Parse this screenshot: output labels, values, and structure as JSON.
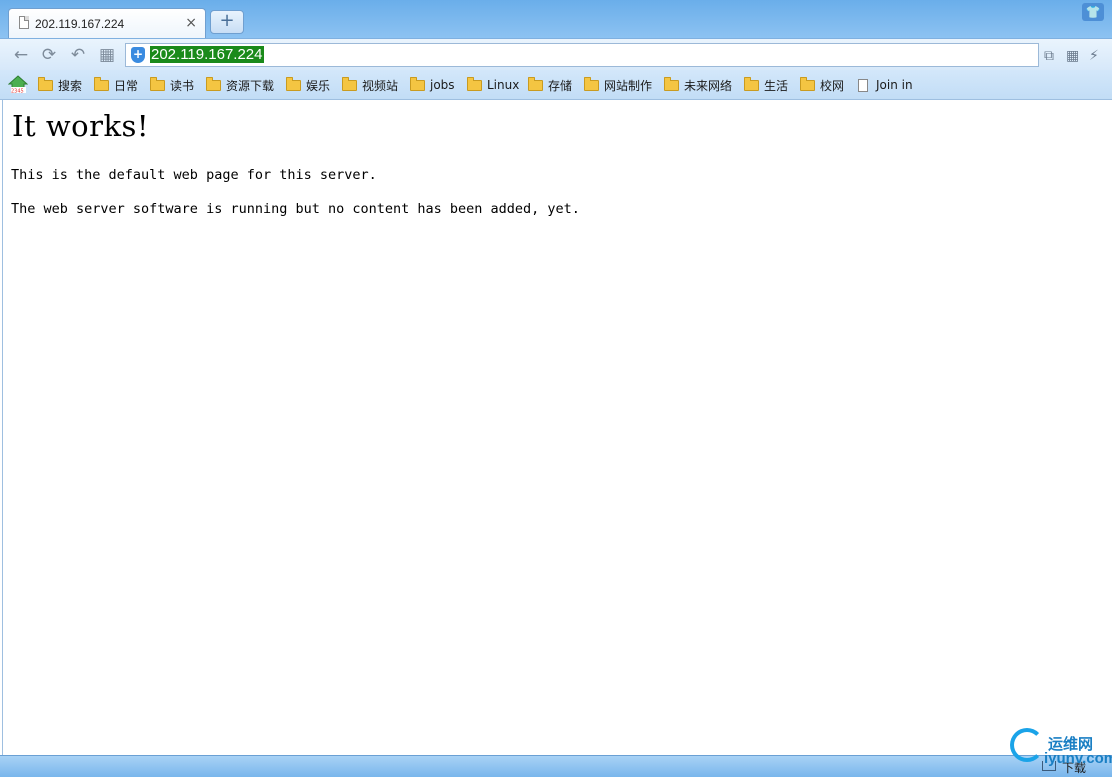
{
  "browser": {
    "tab": {
      "title": "202.119.167.224",
      "close": "×"
    },
    "new_tab": "+",
    "skin": "👕",
    "toolbar": {
      "back": "←",
      "reload": "⟳",
      "undo": "↶",
      "apps": "▦",
      "address": "202.119.167.224",
      "right_icons": [
        "⧉",
        "▦",
        "⚡"
      ]
    },
    "bookmarks": [
      {
        "label": "搜索",
        "type": "folder"
      },
      {
        "label": "日常",
        "type": "folder"
      },
      {
        "label": "读书",
        "type": "folder"
      },
      {
        "label": "资源下载",
        "type": "folder"
      },
      {
        "label": "娱乐",
        "type": "folder"
      },
      {
        "label": "视频站",
        "type": "folder"
      },
      {
        "label": "jobs",
        "type": "folder"
      },
      {
        "label": "Linux",
        "type": "folder"
      },
      {
        "label": "存储",
        "type": "folder"
      },
      {
        "label": "网站制作",
        "type": "folder"
      },
      {
        "label": "未来网络",
        "type": "folder"
      },
      {
        "label": "生活",
        "type": "folder"
      },
      {
        "label": "校网",
        "type": "folder"
      },
      {
        "label": "Join in",
        "type": "page"
      }
    ],
    "home_badge": "2345"
  },
  "page": {
    "heading": "It works!",
    "paragraph1": "This is the default web page for this server.",
    "paragraph2": "The web server software is running but no content has been added, yet."
  },
  "statusbar": {
    "download_label": "下载"
  },
  "watermark": {
    "cn": "运维网",
    "en": "iyunv.com"
  },
  "colors": {
    "url_highlight": "#1a8a1a",
    "chrome_blue": "#8ec3f2"
  }
}
